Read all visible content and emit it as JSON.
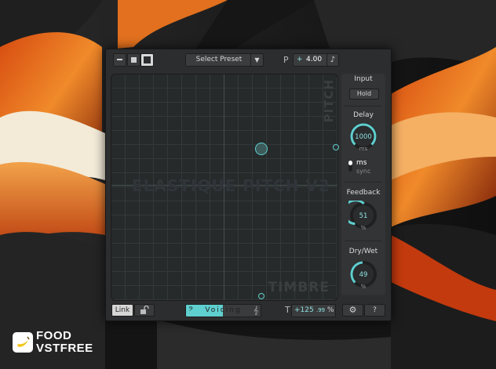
{
  "toolbar": {
    "preset_label": "Select Preset",
    "pitch_letter": "P",
    "pitch_sign": "+",
    "pitch_value": "4.00",
    "note_icon": "music-note-icon"
  },
  "xy_pad": {
    "watermark_pitch": "PITCH",
    "watermark_brand": "ELASTIQUE PITCH V2",
    "watermark_timbre": "TIMBRE",
    "accent_color": "#5fcfcf"
  },
  "sidebar": {
    "input_title": "Input",
    "hold_label": "Hold",
    "delay_title": "Delay",
    "delay_value": "1000",
    "delay_unit": "ms",
    "delay_mode_ms": "ms",
    "delay_mode_sync": "sync",
    "feedback_title": "Feedback",
    "feedback_value": "51",
    "feedback_unit": "%",
    "drywet_title": "Dry/Wet",
    "drywet_value": "49",
    "drywet_unit": "%"
  },
  "bottom": {
    "link_label": "Link",
    "voicing_label": "Voicing",
    "timbre_letter": "T",
    "timbre_value": "+125",
    "timbre_decimal": ".99",
    "timbre_unit": "%",
    "settings_icon": "gear-icon",
    "help_label": "?"
  },
  "branding": {
    "line1": "FOOD",
    "line2": "VSTFREE"
  }
}
